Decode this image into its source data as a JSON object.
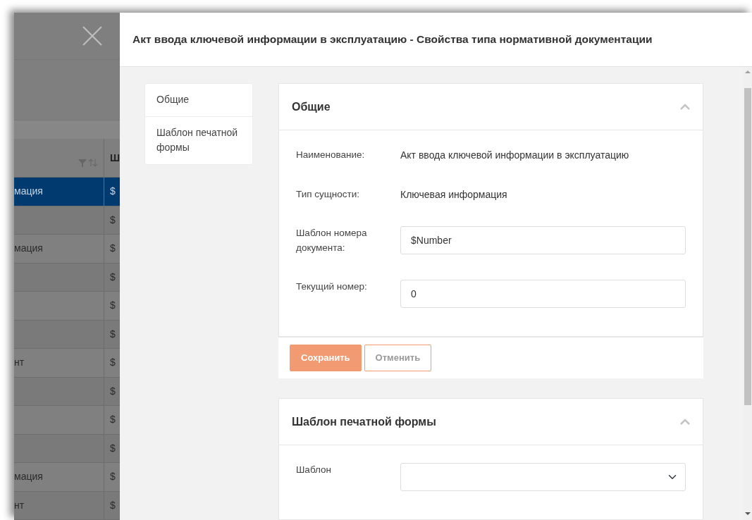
{
  "background_table": {
    "header": {
      "column_2": "Ш"
    },
    "rows": [
      {
        "column_1": "мация",
        "column_2": "$",
        "selected": true
      },
      {
        "column_2": "$",
        "selected": false
      },
      {
        "column_1": "мация",
        "column_2": "$",
        "selected": false
      },
      {
        "column_2": "$",
        "selected": false
      },
      {
        "column_2": "$",
        "selected": false
      },
      {
        "column_2": "$",
        "selected": false
      },
      {
        "column_1": "нт",
        "column_2": "$",
        "selected": false
      },
      {
        "column_2": "$",
        "selected": false
      },
      {
        "column_2": "$",
        "selected": false
      },
      {
        "column_2": "$",
        "selected": false
      },
      {
        "column_1": "мация",
        "column_2": "$",
        "selected": false
      },
      {
        "column_1": "нт",
        "column_2": "$",
        "selected": false
      }
    ]
  },
  "dialog": {
    "title": "Акт ввода ключевой информации в эксплуатацию - Свойства типа нормативной документации",
    "nav": [
      {
        "label": "Общие"
      },
      {
        "label": "Шаблон печатной формы"
      }
    ],
    "sections": [
      {
        "title": "Общие",
        "expanded": true,
        "fields": [
          {
            "kind": "text",
            "label": "Наименование:",
            "value": "Акт ввода ключевой информации в эксплуатацию"
          },
          {
            "kind": "text",
            "label": "Тип сущности:",
            "value": "Ключевая информация"
          },
          {
            "kind": "input",
            "label": "Шаблон номера документа:",
            "value": "$Number"
          },
          {
            "kind": "input",
            "label": "Текущий номер:",
            "value": "0"
          }
        ],
        "buttons": [
          {
            "label": "Сохранить",
            "disabled": false
          },
          {
            "label": "Отменить",
            "disabled": true
          }
        ]
      },
      {
        "title": "Шаблон печатной формы",
        "expanded": true,
        "fields": [
          {
            "kind": "select",
            "label": "Шаблон"
          }
        ]
      }
    ]
  }
}
